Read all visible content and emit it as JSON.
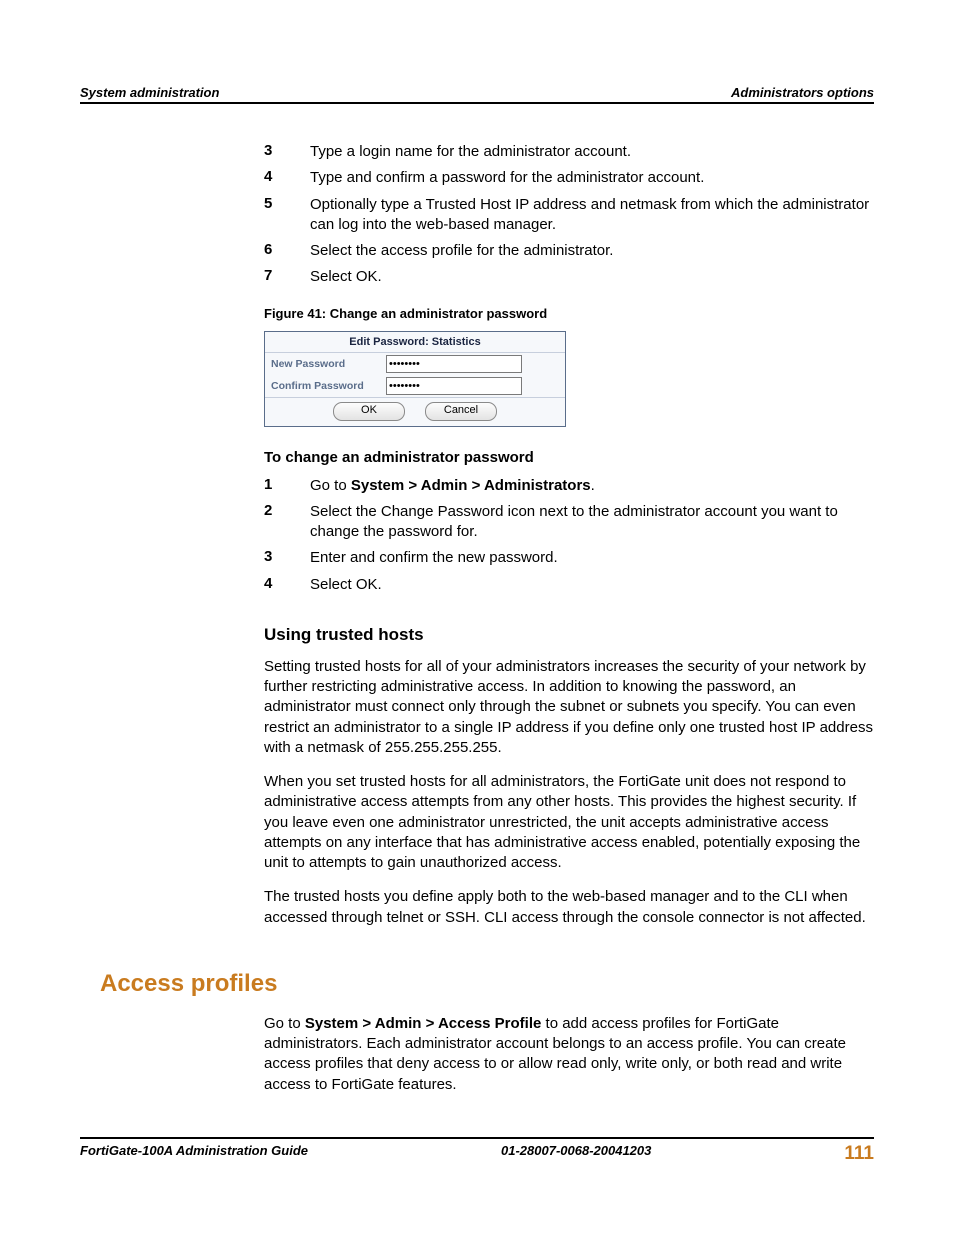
{
  "header": {
    "left": "System administration",
    "right": "Administrators options"
  },
  "stepsA": [
    {
      "n": "3",
      "t": "Type a login name for the administrator account."
    },
    {
      "n": "4",
      "t": "Type and confirm a password for the administrator account."
    },
    {
      "n": "5",
      "t": "Optionally type a Trusted Host IP address and netmask from which the administrator can log into the web-based manager."
    },
    {
      "n": "6",
      "t": "Select the access profile for the administrator."
    },
    {
      "n": "7",
      "t": "Select OK."
    }
  ],
  "figure": {
    "caption": "Figure 41: Change an administrator password",
    "title": "Edit Password: Statistics",
    "row1Label": "New Password",
    "row1Value": "••••••••",
    "row2Label": "Confirm Password",
    "row2Value": "••••••••",
    "ok": "OK",
    "cancel": "Cancel"
  },
  "changePwd": {
    "heading": "To change an administrator password",
    "steps": [
      {
        "n": "1",
        "pre": "Go to ",
        "bold": "System > Admin > Administrators",
        "post": "."
      },
      {
        "n": "2",
        "t": "Select the Change Password icon next to the administrator account you want to change the password for."
      },
      {
        "n": "3",
        "t": "Enter and confirm the new password."
      },
      {
        "n": "4",
        "t": "Select OK."
      }
    ]
  },
  "trusted": {
    "heading": "Using trusted hosts",
    "p1": "Setting trusted hosts for all of your administrators increases the security of your network by further restricting administrative access. In addition to knowing the password, an administrator must connect only through the subnet or subnets you specify. You can even restrict an administrator to a single IP address if you define only one trusted host IP address with a netmask of 255.255.255.255.",
    "p2": "When you set trusted hosts for all administrators, the FortiGate unit does not respond to administrative access attempts from any other hosts. This provides the highest security. If you leave even one administrator unrestricted, the unit accepts administrative access attempts on any interface that has administrative access enabled, potentially exposing the unit to attempts to gain unauthorized access.",
    "p3": "The trusted hosts you define apply both to the web-based manager and to the CLI when accessed through telnet or SSH. CLI access through the console connector is not affected."
  },
  "access": {
    "heading": "Access profiles",
    "p_pre": "Go to ",
    "p_bold": "System > Admin > Access Profile",
    "p_post": " to add access profiles for FortiGate administrators. Each administrator account belongs to an access profile. You can create access profiles that deny access to or allow read only, write only, or both read and write access to FortiGate features."
  },
  "footer": {
    "left": "FortiGate-100A Administration Guide",
    "center": "01-28007-0068-20041203",
    "page": "111"
  }
}
